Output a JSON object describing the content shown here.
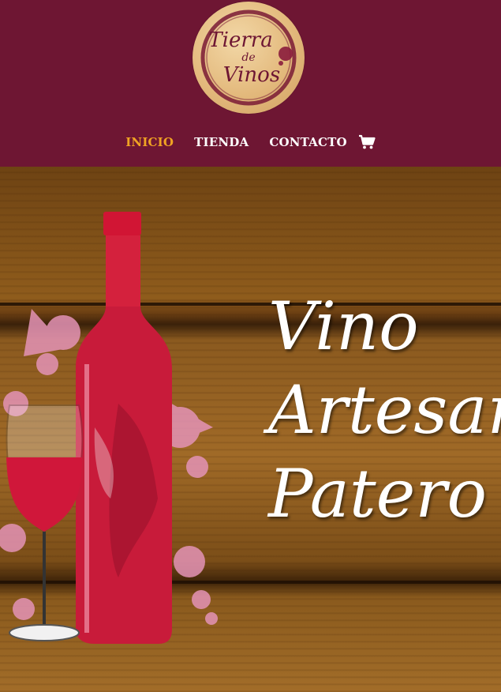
{
  "logo": {
    "line1": "Tierra",
    "line2": "de",
    "line3": "Vinos"
  },
  "nav": {
    "items": [
      {
        "label": "INICIO",
        "active": true
      },
      {
        "label": "TIENDA",
        "active": false
      },
      {
        "label": "CONTACTO",
        "active": false
      }
    ],
    "cart_icon": "shopping-cart-icon"
  },
  "hero": {
    "line1": "Vino",
    "line2": "Artesanal",
    "line3": "Patero"
  },
  "colors": {
    "header_bg": "#6e1633",
    "nav_active": "#f0a323",
    "nav_text": "#ffffff",
    "wine_red": "#c8102e"
  }
}
